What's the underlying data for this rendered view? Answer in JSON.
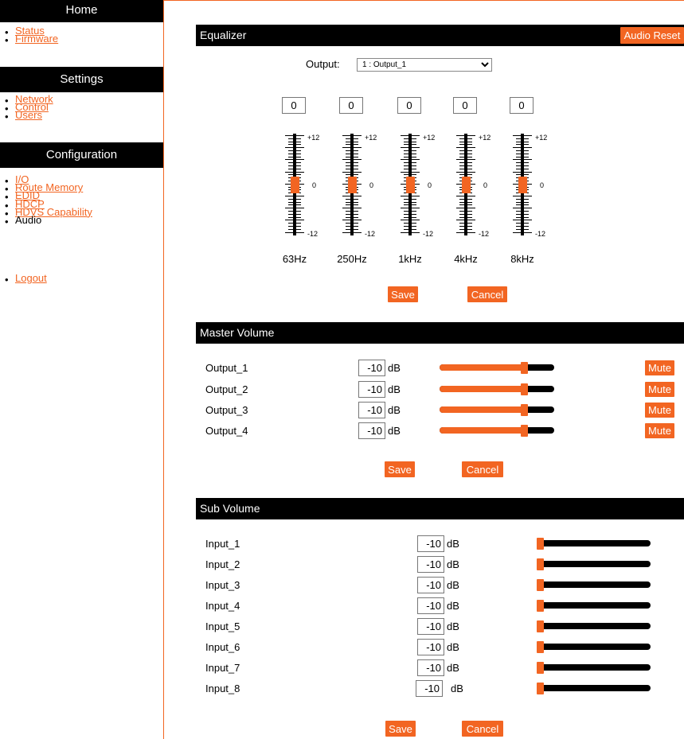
{
  "sidebar": {
    "home_title": "Home",
    "home_items": [
      {
        "label": "Status"
      },
      {
        "label": "Firmware"
      }
    ],
    "settings_title": "Settings",
    "settings_items": [
      {
        "label": "Network"
      },
      {
        "label": "Control"
      },
      {
        "label": "Users"
      }
    ],
    "config_title": "Configuration",
    "config_items": [
      {
        "label": "I/O"
      },
      {
        "label": "Route Memory"
      },
      {
        "label": "EDID"
      },
      {
        "label": "HDCP"
      },
      {
        "label": "HDVS Capability"
      },
      {
        "label": "Audio"
      }
    ],
    "logout_label": "Logout",
    "bullet": "•"
  },
  "equalizer": {
    "title": "Equalizer",
    "reset_label": "Audio Reset",
    "output_label": "Output:",
    "output_selected": "1 : Output_1",
    "bands": [
      {
        "freq": "63Hz",
        "value": "0",
        "level": 0
      },
      {
        "freq": "250Hz",
        "value": "0",
        "level": 0
      },
      {
        "freq": "1kHz",
        "value": "0",
        "level": 0
      },
      {
        "freq": "4kHz",
        "value": "0",
        "level": 0
      },
      {
        "freq": "8kHz",
        "value": "0",
        "level": 0
      }
    ],
    "scale_top": "+12",
    "scale_mid": "0",
    "scale_bottom": "-12",
    "save_label": "Save",
    "cancel_label": "Cancel"
  },
  "master_volume": {
    "title": "Master Volume",
    "unit": "dB",
    "mute_label": "Mute",
    "outputs": [
      {
        "name": "Output_1",
        "value": "-10",
        "level": 0.75
      },
      {
        "name": "Output_2",
        "value": "-10",
        "level": 0.75
      },
      {
        "name": "Output_3",
        "value": "-10",
        "level": 0.75
      },
      {
        "name": "Output_4",
        "value": "-10",
        "level": 0.75
      }
    ],
    "save_label": "Save",
    "cancel_label": "Cancel"
  },
  "sub_volume": {
    "title": "Sub Volume",
    "unit": "dB",
    "inputs": [
      {
        "name": "Input_1",
        "value": "-10",
        "level": 0
      },
      {
        "name": "Input_2",
        "value": "-10",
        "level": 0
      },
      {
        "name": "Input_3",
        "value": "-10",
        "level": 0
      },
      {
        "name": "Input_4",
        "value": "-10",
        "level": 0
      },
      {
        "name": "Input_5",
        "value": "-10",
        "level": 0
      },
      {
        "name": "Input_6",
        "value": "-10",
        "level": 0
      },
      {
        "name": "Input_7",
        "value": "-10",
        "level": 0
      },
      {
        "name": "Input_8",
        "value": "-10",
        "level": 0
      }
    ],
    "save_label": "Save",
    "cancel_label": "Cancel"
  },
  "colors": {
    "accent": "#f26522",
    "header_bg": "#000000",
    "link": "#f26522"
  }
}
